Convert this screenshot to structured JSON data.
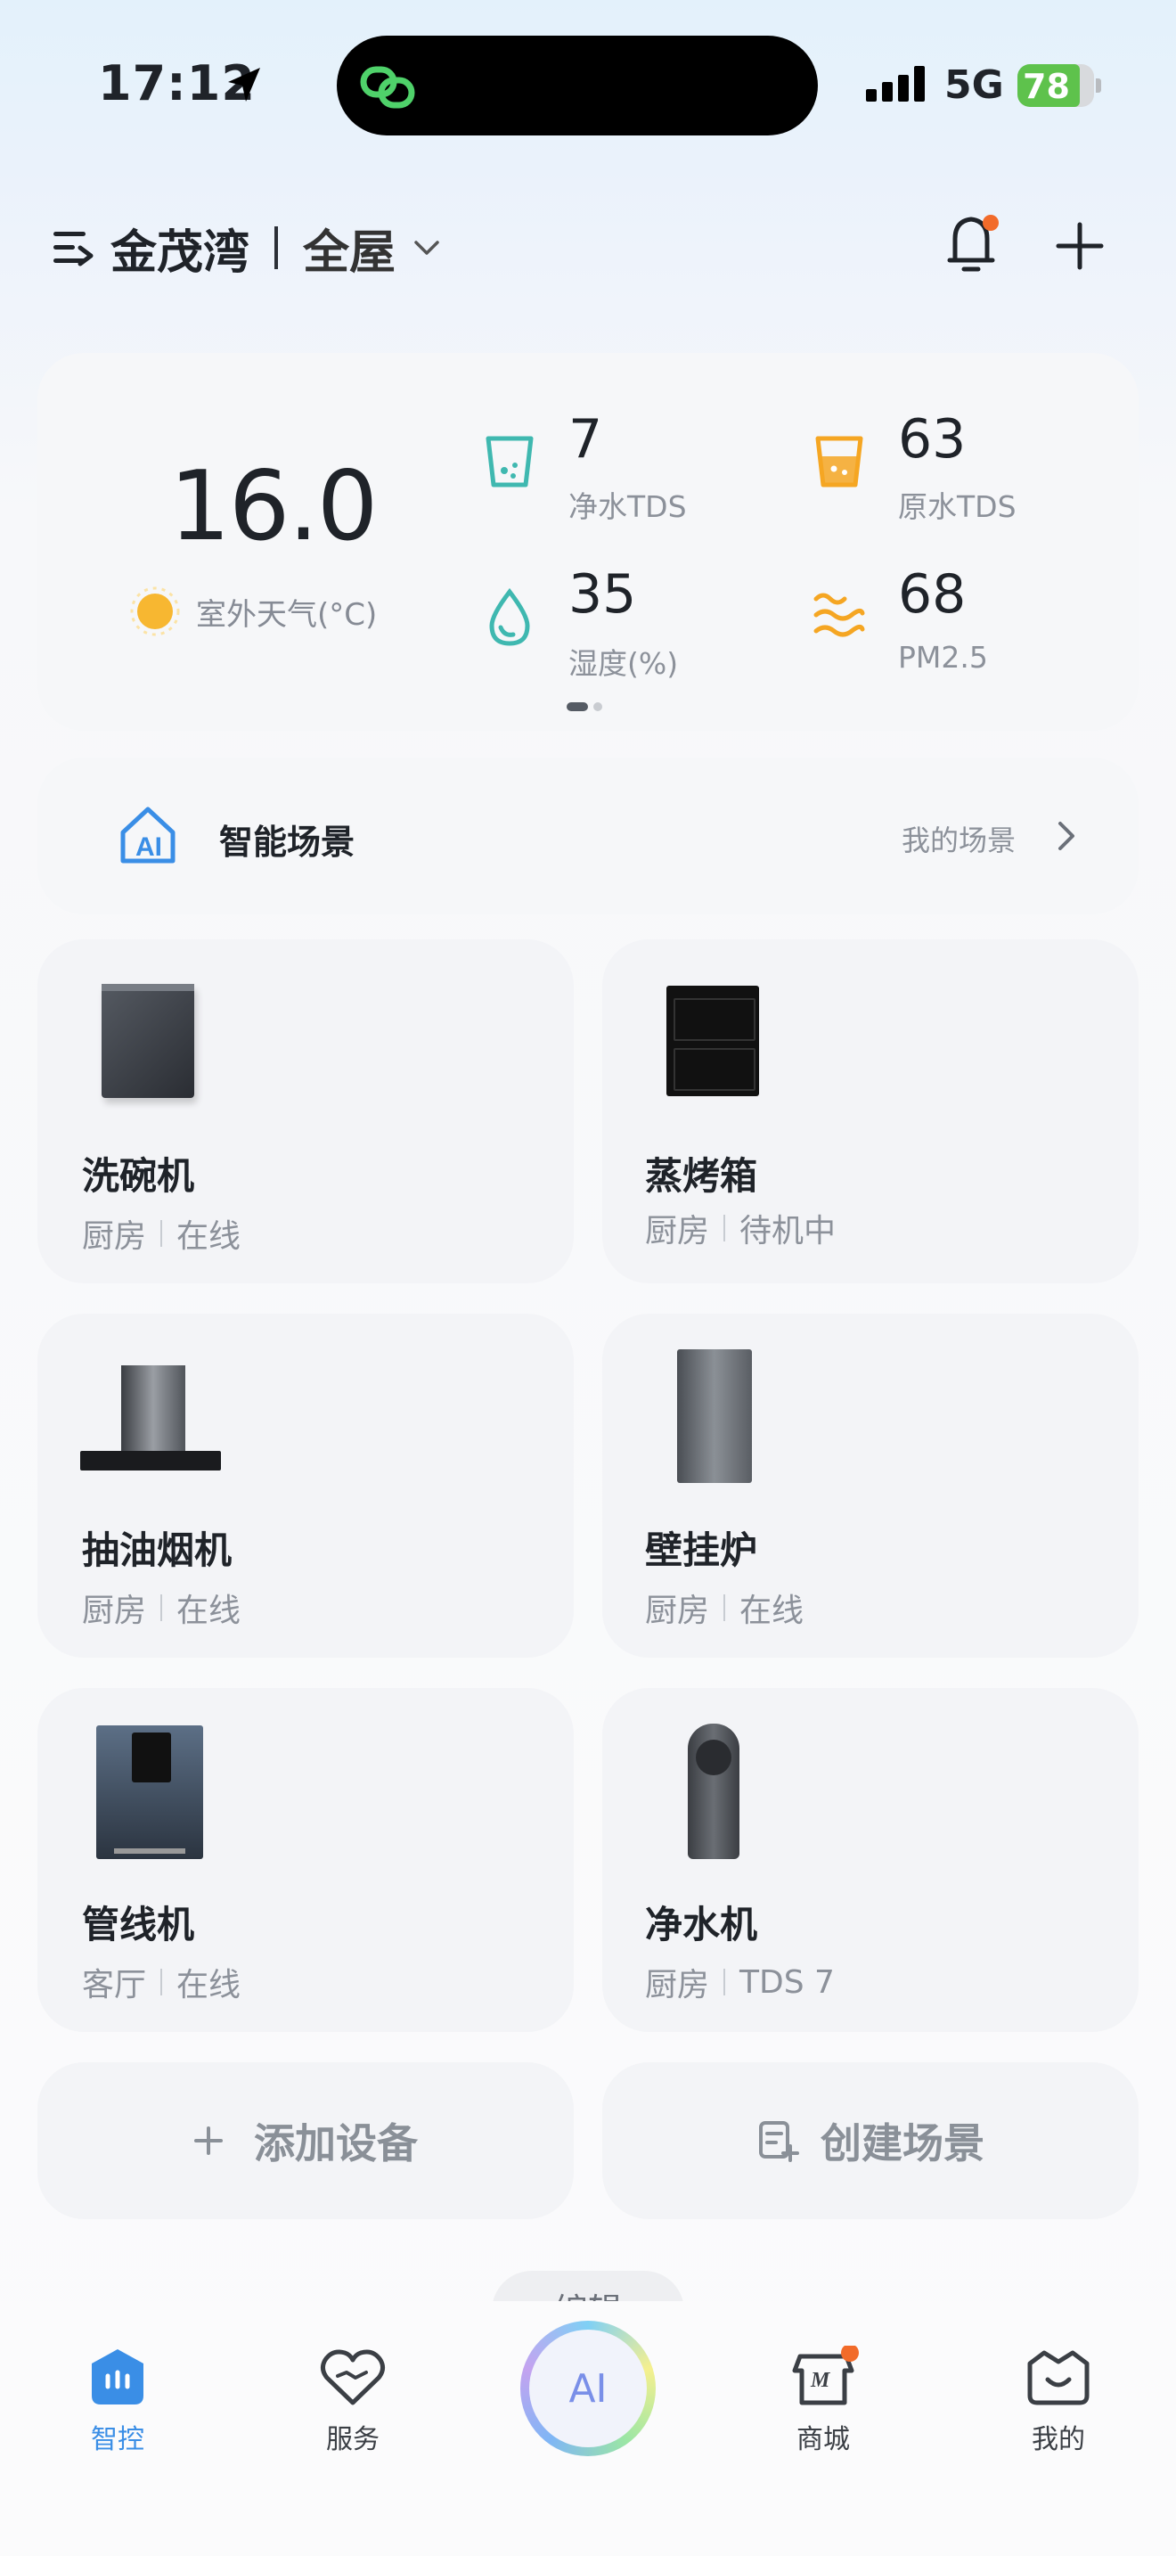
{
  "status_bar": {
    "time": "17:12",
    "network": "5G",
    "battery": "78"
  },
  "header": {
    "home_name": "金茂湾",
    "room_name": "全屋"
  },
  "weather": {
    "temperature": "16.0",
    "temperature_label": "室外天气(°C)",
    "stats": [
      {
        "value": "7",
        "label": "净水TDS"
      },
      {
        "value": "63",
        "label": "原水TDS"
      },
      {
        "value": "35",
        "label": "湿度(%)"
      },
      {
        "value": "68",
        "label": "PM2.5"
      }
    ]
  },
  "scene_bar": {
    "title": "智能场景",
    "link": "我的场景"
  },
  "devices": [
    {
      "name": "洗碗机",
      "room": "厨房",
      "status": "在线"
    },
    {
      "name": "蒸烤箱",
      "room": "厨房",
      "status": "待机中"
    },
    {
      "name": "抽油烟机",
      "room": "厨房",
      "status": "在线"
    },
    {
      "name": "壁挂炉",
      "room": "厨房",
      "status": "在线"
    },
    {
      "name": "管线机",
      "room": "客厅",
      "status": "在线"
    },
    {
      "name": "净水机",
      "room": "厨房",
      "status": "TDS 7"
    }
  ],
  "actions": {
    "add_device": "添加设备",
    "create_scene": "创建场景"
  },
  "edit_label": "编辑",
  "tabs": [
    {
      "label": "智控"
    },
    {
      "label": "服务"
    },
    {
      "label": "AI"
    },
    {
      "label": "商城"
    },
    {
      "label": "我的"
    }
  ],
  "colors": {
    "accent": "#3a8ee6",
    "teal": "#3fb8b0",
    "orange": "#f5a623",
    "badge": "#f26b2a"
  }
}
